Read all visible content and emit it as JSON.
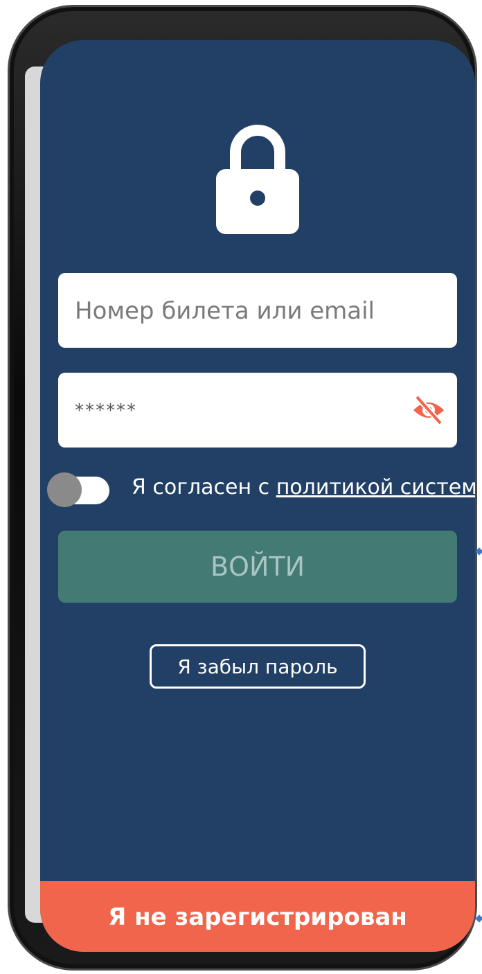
{
  "login": {
    "login_placeholder": "Номер билета или email",
    "password_placeholder": "******"
  },
  "consent": {
    "prefix": "Я согласен с ",
    "link": "политикой систем"
  },
  "buttons": {
    "login": "ВОЙТИ",
    "forgot": "Я забыл пароль",
    "register": "Я не зарегистрирован"
  },
  "icons": {
    "lock": "lock-icon",
    "eye": "eye-off-icon"
  },
  "colors": {
    "background": "#224065",
    "login_button": "#447a74",
    "register_bar": "#f0654b",
    "eye_icon": "#f0654b"
  }
}
